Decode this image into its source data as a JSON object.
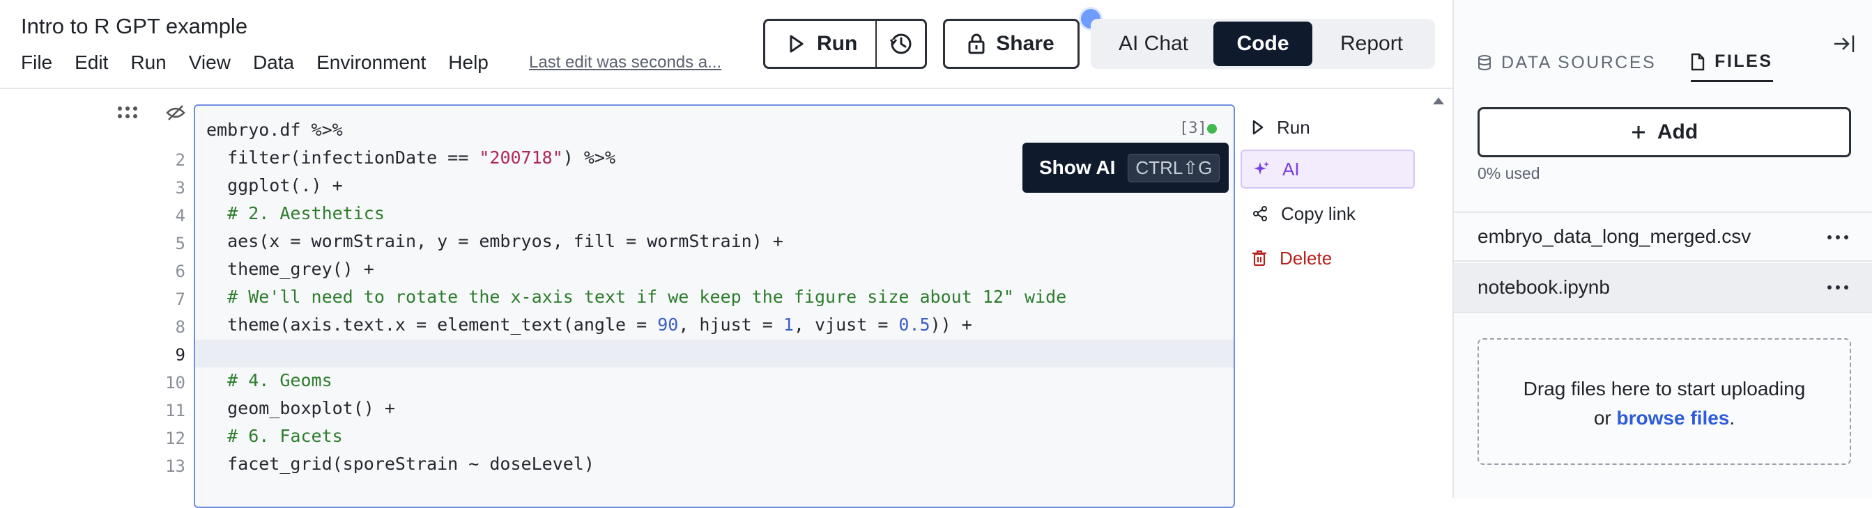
{
  "header": {
    "title": "Intro to R GPT example",
    "menu": [
      "File",
      "Edit",
      "Run",
      "View",
      "Data",
      "Environment",
      "Help"
    ],
    "last_edit": "Last edit was seconds a...",
    "run_label": "Run",
    "share_label": "Share",
    "modes": {
      "ai_chat": "AI Chat",
      "code": "Code",
      "report": "Report"
    }
  },
  "right_panel": {
    "tabs": {
      "data_sources": "DATA SOURCES",
      "files": "FILES"
    },
    "add_label": "Add",
    "usage": "0% used",
    "files": [
      "embryo_data_long_merged.csv",
      "notebook.ipynb"
    ],
    "dropzone": {
      "line1": "Drag files here to start uploading",
      "or": "or ",
      "link": "browse files",
      "end": "."
    }
  },
  "cell": {
    "exec_count": "[3]",
    "line_numbers": [
      "2",
      "3",
      "4",
      "5",
      "6",
      "7",
      "8",
      "9",
      "10",
      "11",
      "12",
      "13"
    ],
    "lines": [
      "embryo.df %>%",
      "  filter(infectionDate == \"200718\") %>%",
      "  ggplot(.) +",
      "  # 2. Aesthetics",
      "  aes(x = wormStrain, y = embryos, fill = wormStrain) +",
      "  theme_grey() +",
      "  # We'll need to rotate the x-axis text if we keep the figure size about 12\" wide",
      "  theme(axis.text.x = element_text(angle = 90, hjust = 1, vjust = 0.5)) +",
      "",
      "  # 4. Geoms",
      "  geom_boxplot() +",
      "  # 6. Facets",
      "  facet_grid(sporeStrain ~ doseLevel)"
    ]
  },
  "tooltip": {
    "label": "Show AI",
    "shortcut": "CTRL⇧G"
  },
  "actions": {
    "run": "Run",
    "ai": "AI",
    "copy_link": "Copy link",
    "delete": "Delete"
  },
  "colors": {
    "accent": "#0f1b2d",
    "link": "#2e5bdb",
    "ai": "#7b3fe0",
    "danger": "#b4231b",
    "status_ok": "#3fb950"
  }
}
